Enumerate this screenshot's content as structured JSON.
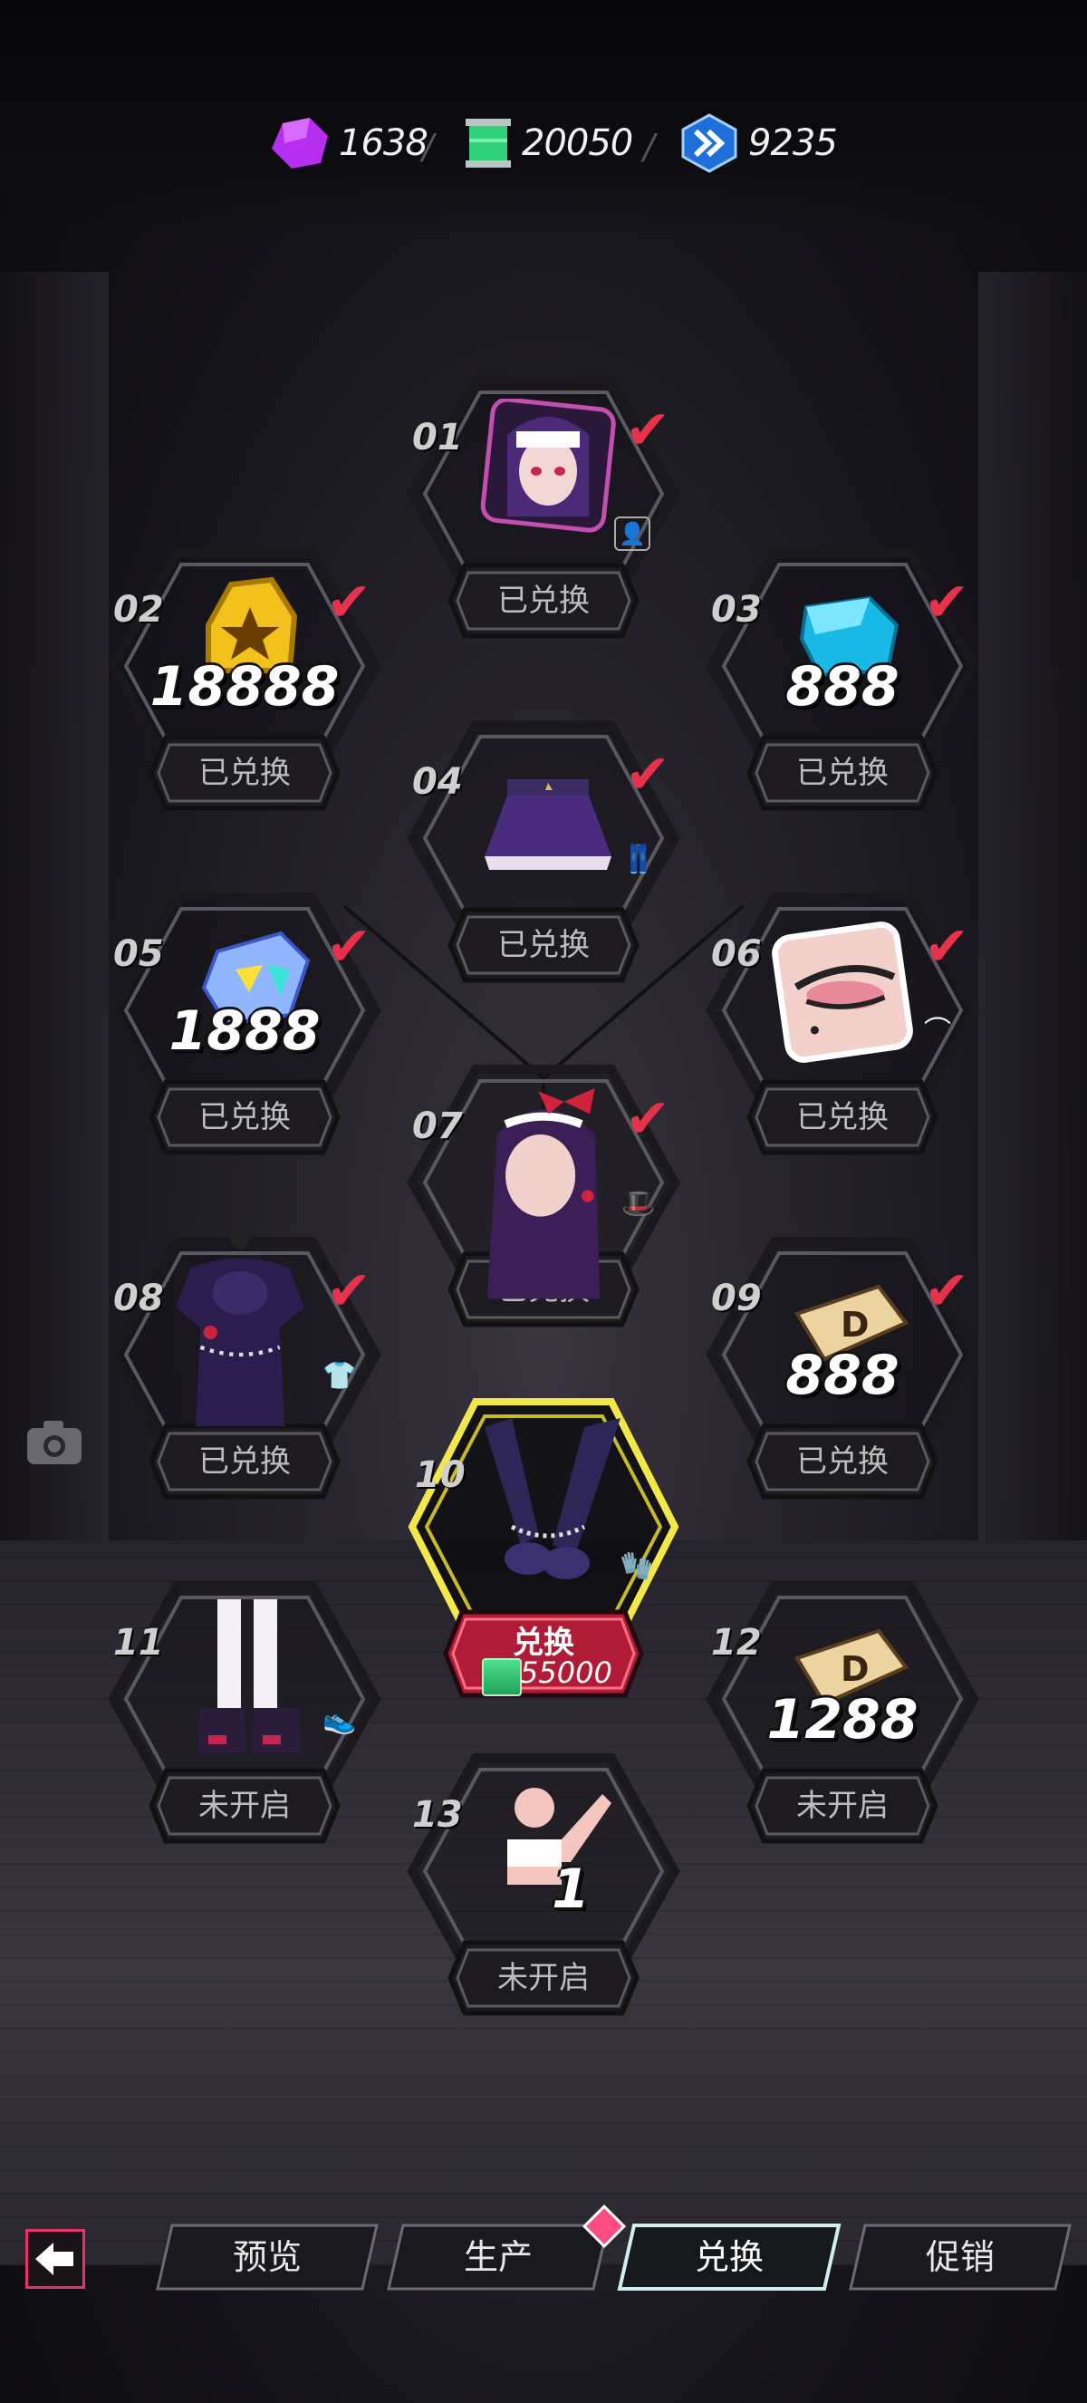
{
  "currencies": [
    {
      "name": "crystal",
      "icon": "purple-crystal-icon",
      "value": "1638"
    },
    {
      "name": "film-reel",
      "icon": "green-scroll-icon",
      "value": "20050"
    },
    {
      "name": "ticket",
      "icon": "blue-chevron-badge-icon",
      "value": "9235"
    }
  ],
  "separator": "/",
  "status": {
    "redeemed": "已兑换",
    "locked": "未开启"
  },
  "nodes": [
    {
      "num": "01",
      "amount": "",
      "item": "avatar-portrait",
      "type_icon": "profile-icon",
      "status": "已兑换",
      "checked": true
    },
    {
      "num": "02",
      "amount": "18888",
      "item": "gold-star-coin",
      "type_icon": "",
      "status": "已兑换",
      "checked": true
    },
    {
      "num": "03",
      "amount": "888",
      "item": "blue-gem",
      "type_icon": "",
      "status": "已兑换",
      "checked": true
    },
    {
      "num": "04",
      "amount": "",
      "item": "purple-skirt",
      "type_icon": "pants-icon",
      "status": "已兑换",
      "checked": true
    },
    {
      "num": "05",
      "amount": "1888",
      "item": "crystal-shard",
      "type_icon": "",
      "status": "已兑换",
      "checked": true
    },
    {
      "num": "06",
      "amount": "",
      "item": "eye-makeup",
      "type_icon": "eye-icon",
      "status": "已兑换",
      "checked": true
    },
    {
      "num": "07",
      "amount": "",
      "item": "purple-hair-bow",
      "type_icon": "hat-icon",
      "status": "已兑换",
      "checked": true
    },
    {
      "num": "08",
      "amount": "",
      "item": "purple-dress",
      "type_icon": "shirt-icon",
      "status": "已兑换",
      "checked": true
    },
    {
      "num": "09",
      "amount": "888",
      "item": "d-ticket",
      "type_icon": "",
      "status": "已兑换",
      "checked": true
    },
    {
      "num": "10",
      "amount": "",
      "item": "purple-gloves",
      "type_icon": "glove-icon",
      "status": "",
      "checked": false
    },
    {
      "num": "11",
      "amount": "",
      "item": "white-stockings-shoes",
      "type_icon": "shoe-icon",
      "status": "未开启",
      "checked": false
    },
    {
      "num": "12",
      "amount": "1288",
      "item": "d-ticket",
      "type_icon": "",
      "status": "未开启",
      "checked": false
    },
    {
      "num": "13",
      "amount": "",
      "item": "pose-action",
      "type_icon": "",
      "status": "未开启",
      "checked": false
    }
  ],
  "active": {
    "label": "兑换",
    "cost": "55000",
    "cost_icon": "green-scroll-icon",
    "frame_color": "#f2e84a",
    "button_color": "#e8314b"
  },
  "pose_badge": "1",
  "check_color": "#e8314b",
  "nav": {
    "back_icon": "arrow-left-icon",
    "tabs": [
      {
        "label": "预览",
        "active": false
      },
      {
        "label": "生产",
        "active": false
      },
      {
        "label": "兑换",
        "active": true
      },
      {
        "label": "促销",
        "active": false
      }
    ],
    "accent": "#ff4c83"
  }
}
